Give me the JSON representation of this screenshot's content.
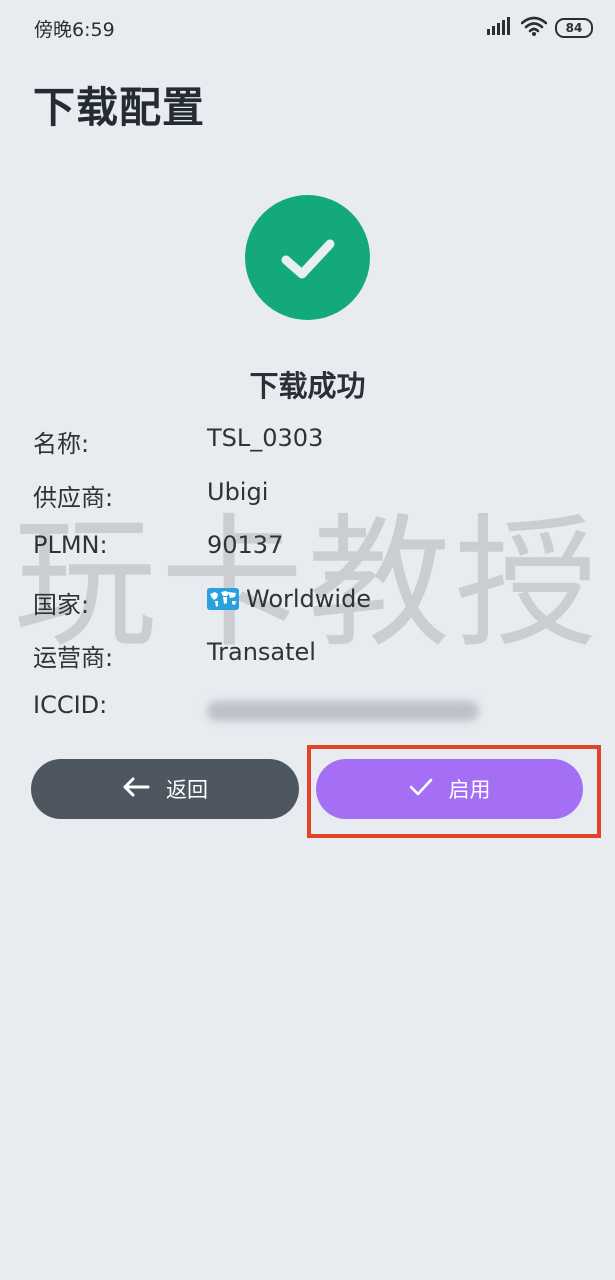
{
  "status_bar": {
    "time": "傍晚6:59",
    "battery": "84",
    "icons": [
      "signal-icon",
      "wifi-icon",
      "battery-icon"
    ]
  },
  "page": {
    "title": "下载配置",
    "success_text": "下载成功",
    "watermark": "玩卡教授"
  },
  "profile": {
    "rows": [
      {
        "label": "名称:",
        "value": "TSL_0303"
      },
      {
        "label": "供应商:",
        "value": "Ubigi"
      },
      {
        "label": "PLMN:",
        "value": "90137"
      },
      {
        "label": "国家:",
        "value": "Worldwide",
        "icon": "world-map-icon"
      },
      {
        "label": "运营商:",
        "value": "Transatel"
      },
      {
        "label": "ICCID:",
        "value": null,
        "blurred": true
      }
    ]
  },
  "actions": {
    "back_label": "返回",
    "enable_label": "启用"
  },
  "colors": {
    "background": "#e8ebf0",
    "success": "#14a97c",
    "back_button": "#4e5760",
    "enable_button": "#a56ff5",
    "highlight": "#e0432a"
  }
}
